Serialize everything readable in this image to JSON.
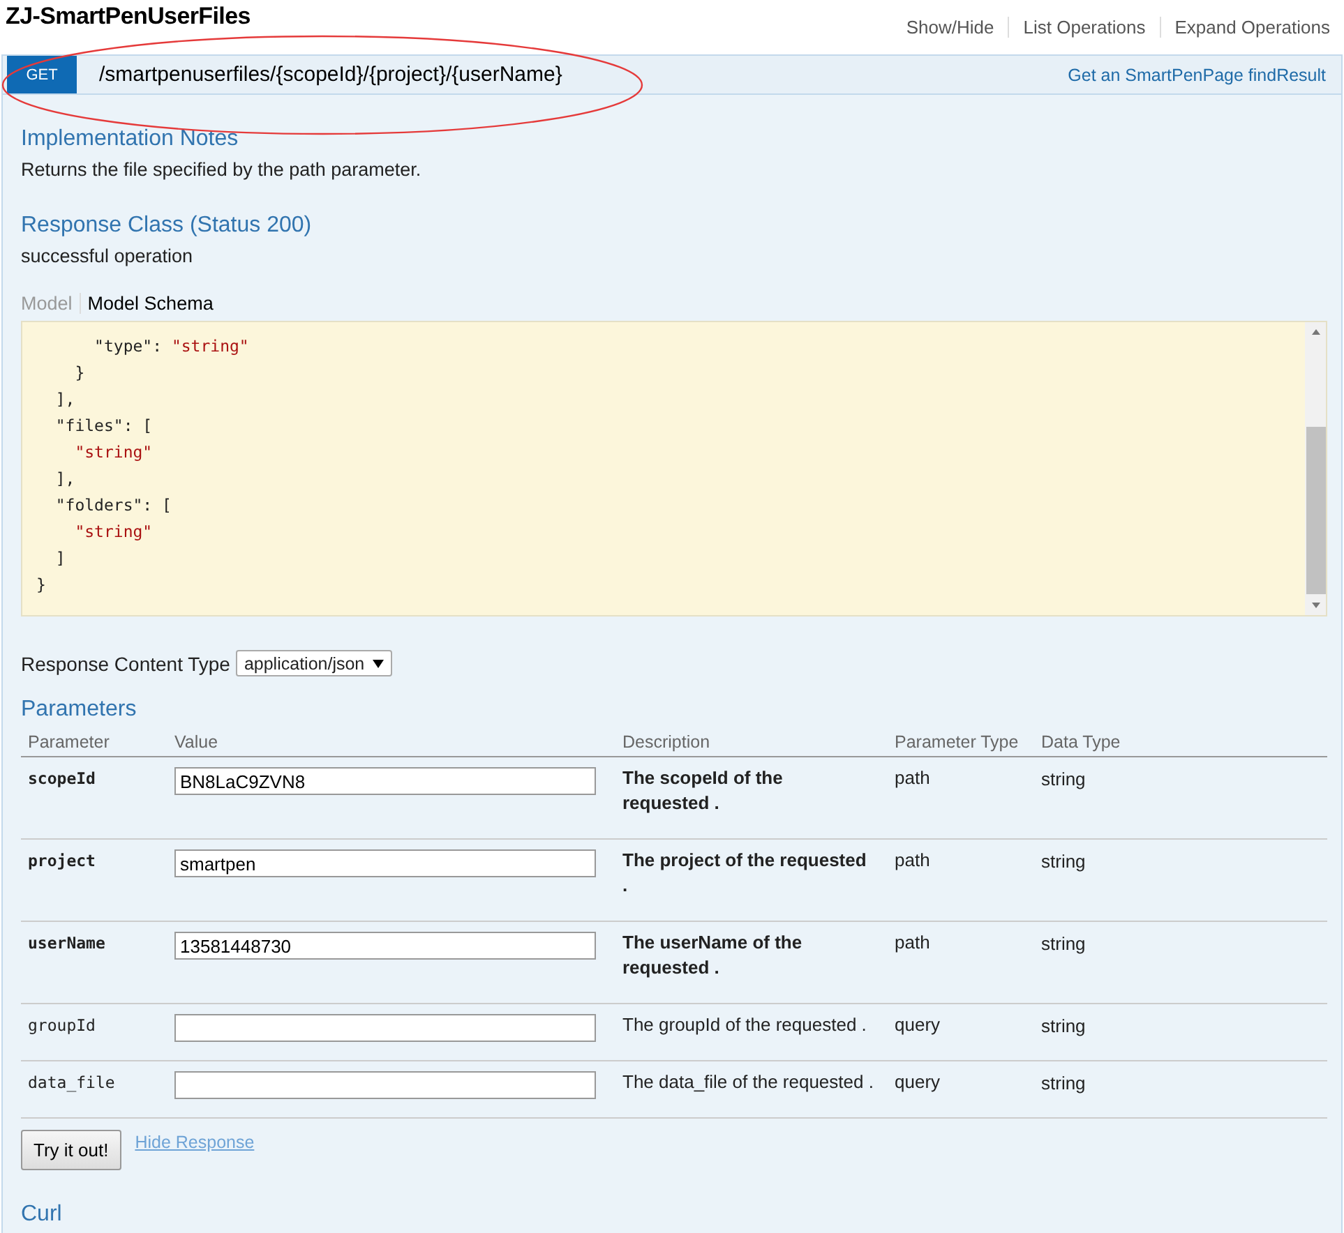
{
  "resource": {
    "title": "ZJ-SmartPenUserFiles",
    "links": [
      "Show/Hide",
      "List Operations",
      "Expand Operations"
    ]
  },
  "operation": {
    "method": "GET",
    "path": "/smartpenuserfiles/{scopeId}/{project}/{userName}",
    "summary": "Get an SmartPenPage findResult"
  },
  "implementation_notes": {
    "heading": "Implementation Notes",
    "text": "Returns the file specified by the path parameter."
  },
  "response_class": {
    "heading": "Response Class (Status 200)",
    "text": "successful operation"
  },
  "model_tabs": [
    {
      "label": "Model",
      "selected": false
    },
    {
      "label": "Model Schema",
      "selected": true
    }
  ],
  "schema_lines": [
    "      \"type\": \"string\"",
    "    }",
    "  ],",
    "  \"files\": [",
    "    \"string\"",
    "  ],",
    "  \"folders\": [",
    "    \"string\"",
    "  ]",
    "}"
  ],
  "response_content_type": {
    "label": "Response Content Type",
    "value": "application/json"
  },
  "parameters": {
    "heading": "Parameters",
    "columns": [
      "Parameter",
      "Value",
      "Description",
      "Parameter Type",
      "Data Type"
    ],
    "rows": [
      {
        "name": "scopeId",
        "value": "BN8LaC9ZVN8",
        "description": "The scopeId of the requested .",
        "parameter_type": "path",
        "data_type": "string",
        "required": true
      },
      {
        "name": "project",
        "value": "smartpen",
        "description": "The project of the requested .",
        "parameter_type": "path",
        "data_type": "string",
        "required": true
      },
      {
        "name": "userName",
        "value": "13581448730",
        "description": "The userName of the requested .",
        "parameter_type": "path",
        "data_type": "string",
        "required": true
      },
      {
        "name": "groupId",
        "value": "",
        "description": "The groupId of the requested .",
        "parameter_type": "query",
        "data_type": "string",
        "required": false
      },
      {
        "name": "data_file",
        "value": "",
        "description": "The data_file of the requested .",
        "parameter_type": "query",
        "data_type": "string",
        "required": false
      }
    ]
  },
  "buttons": {
    "try": "Try it out!",
    "hide": "Hide Response"
  },
  "curl": {
    "heading": "Curl"
  }
}
